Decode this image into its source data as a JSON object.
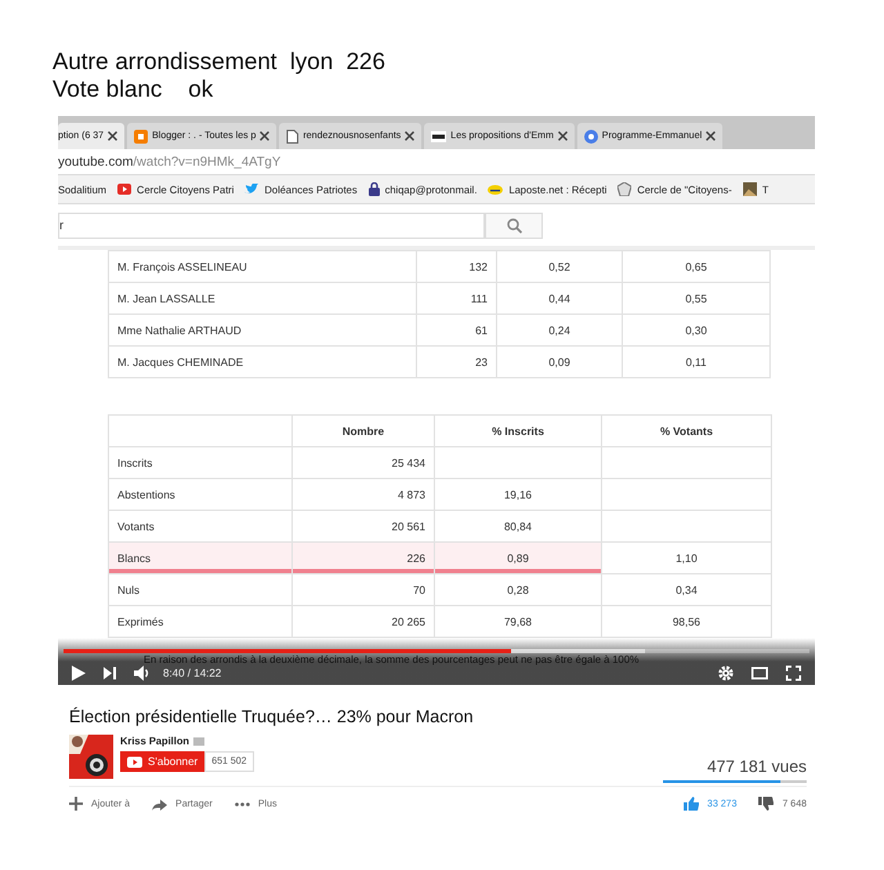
{
  "caption": [
    "Autre arrondissement  lyon  226",
    "Vote blanc    ok"
  ],
  "tabs": [
    {
      "label": "ption (6 37",
      "kind": "none",
      "selected": true
    },
    {
      "label": "Blogger : . - Toutes les p",
      "kind": "blogger",
      "selected": false
    },
    {
      "label": "rendeznousnosenfants",
      "kind": "page",
      "selected": false
    },
    {
      "label": "Les propositions d'Emm",
      "kind": "logo",
      "selected": false
    },
    {
      "label": "Programme-Emmanuel",
      "kind": "globe",
      "selected": false
    }
  ],
  "address": {
    "host": "youtube.com",
    "path": "/watch?v=n9HMk_4ATgY"
  },
  "bookmarks": [
    {
      "label": "Sodalitium",
      "kind": "none"
    },
    {
      "label": "Cercle Citoyens Patri",
      "kind": "play"
    },
    {
      "label": "Doléances Patriotes",
      "kind": "bird"
    },
    {
      "label": "chiqap@protonmail.",
      "kind": "lock"
    },
    {
      "label": "Laposte.net : Récepti",
      "kind": "ellipse"
    },
    {
      "label": "Cercle de \"Citoyens-",
      "kind": "emblem"
    },
    {
      "label": "T",
      "kind": "image"
    }
  ],
  "search": {
    "value": "r"
  },
  "candidates_table": {
    "rows": [
      [
        "M. François ASSELINEAU",
        "132",
        "0,52",
        "0,65"
      ],
      [
        "M. Jean LASSALLE",
        "111",
        "0,44",
        "0,55"
      ],
      [
        "Mme Nathalie ARTHAUD",
        "61",
        "0,24",
        "0,30"
      ],
      [
        "M. Jacques CHEMINADE",
        "23",
        "0,09",
        "0,11"
      ]
    ]
  },
  "totals_table": {
    "columns": [
      "",
      "Nombre",
      "% Inscrits",
      "% Votants"
    ],
    "rows": [
      {
        "cells": [
          "Inscrits",
          "25 434",
          "",
          ""
        ],
        "underlined": false
      },
      {
        "cells": [
          "Abstentions",
          "4 873",
          "19,16",
          ""
        ],
        "underlined": false
      },
      {
        "cells": [
          "Votants",
          "20 561",
          "80,84",
          ""
        ],
        "underlined": false
      },
      {
        "cells": [
          "Blancs",
          "226",
          "0,89",
          "1,10"
        ],
        "underlined": true
      },
      {
        "cells": [
          "Nuls",
          "70",
          "0,28",
          "0,34"
        ],
        "underlined": false
      },
      {
        "cells": [
          "Exprimés",
          "20 265",
          "79,68",
          "98,56"
        ],
        "underlined": false
      }
    ]
  },
  "player": {
    "subtitle": "En raison des arrondis à la deuxième décimale, la somme des pourcentages peut ne pas être égale à 100%",
    "time": "8:40 / 14:22",
    "progress": {
      "level": 0.6
    }
  },
  "video": {
    "title": "Élection présidentielle Truquée?… 23% pour Macron",
    "channel": "Kriss Papillon",
    "subscribe": "S'abonner",
    "subscribers": "651 502",
    "views": "477 181 vues",
    "rating": {
      "level": 0.82
    },
    "actions": [
      {
        "label": "Ajouter à",
        "kind": "plus"
      },
      {
        "label": "Partager",
        "kind": "share"
      },
      {
        "label": "Plus",
        "kind": "more"
      }
    ],
    "likes": "33 273",
    "dislikes": "7 648"
  }
}
